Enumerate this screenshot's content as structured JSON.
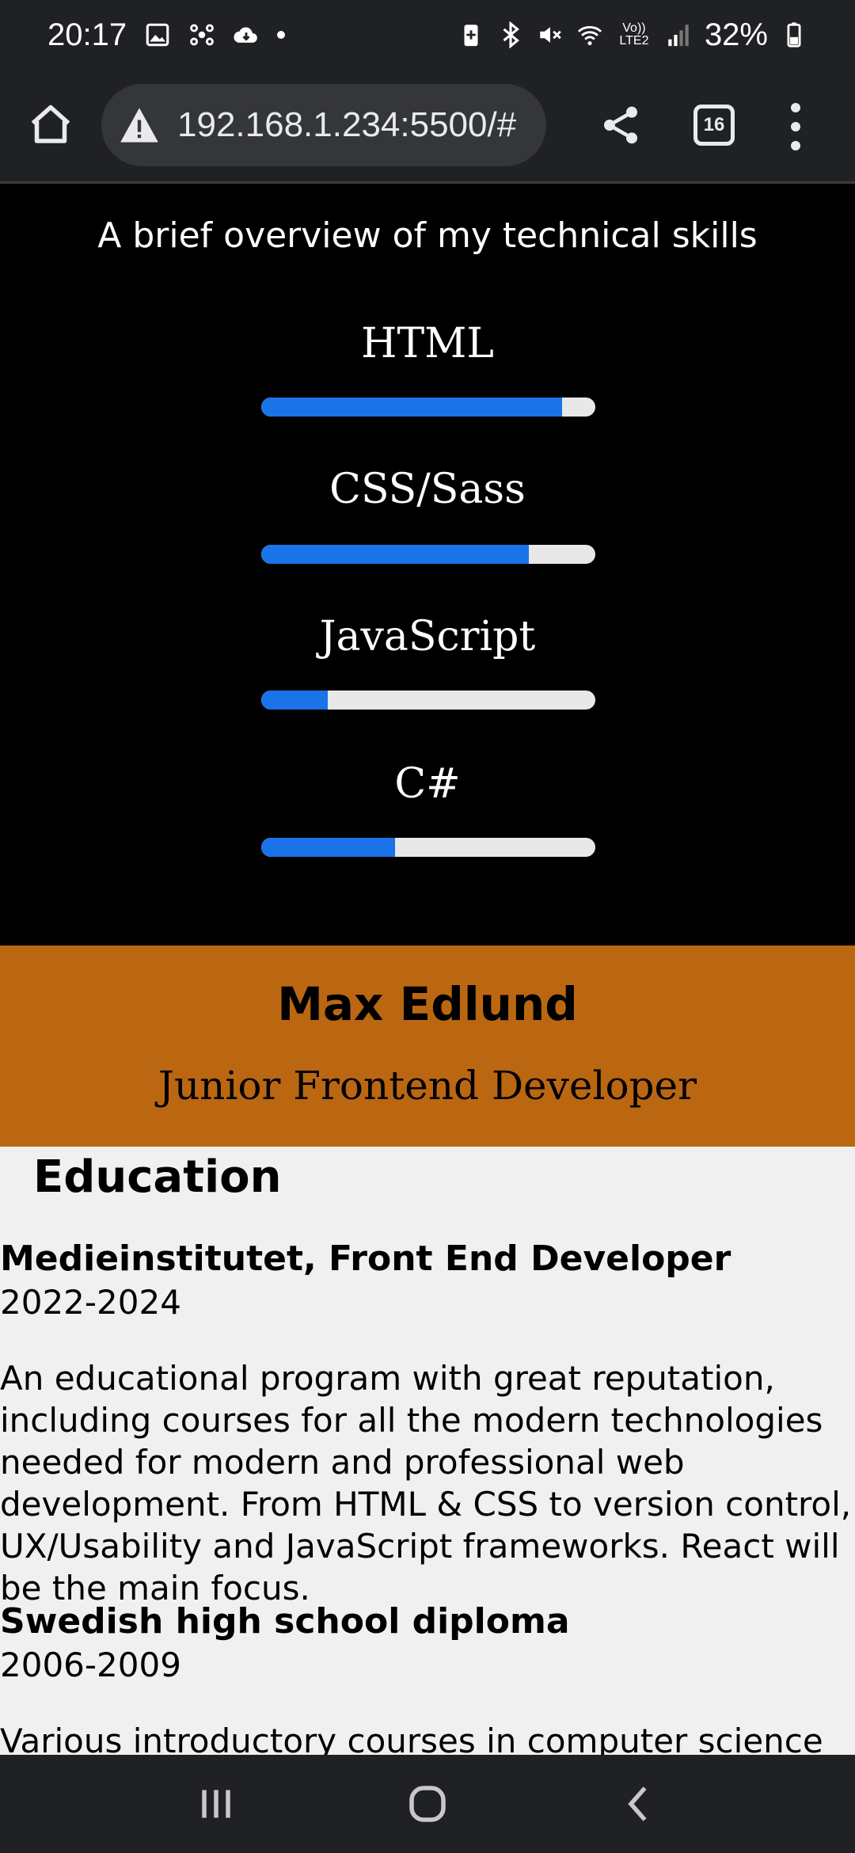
{
  "status_bar": {
    "time": "20:17",
    "battery": "32%",
    "network_label": "Vo)) LTE2"
  },
  "browser": {
    "url": "192.168.1.234:5500/#",
    "tab_count": "16"
  },
  "skills": {
    "intro": "A brief overview of my technical skills",
    "items": [
      {
        "label": "HTML",
        "level": 0.9
      },
      {
        "label": "CSS/Sass",
        "level": 0.8
      },
      {
        "label": "JavaScript",
        "level": 0.2
      },
      {
        "label": "C#",
        "level": 0.4
      }
    ]
  },
  "hero": {
    "name": "Max Edlund",
    "role": "Junior Frontend Developer"
  },
  "education": {
    "title": "Education",
    "items": [
      {
        "title": "Medieinstitutet, Front End Developer",
        "years": "2022-2024",
        "description": "An educational program with great reputation, including courses for all the modern technologies needed for modern and professional web development. From HTML & CSS to version control, UX/Usability and JavaScript frameworks. React will be the main focus."
      },
      {
        "title": "Swedish high school diploma",
        "years": "2006-2009",
        "description": "Various introductory courses in computer science and"
      }
    ]
  },
  "colors": {
    "accent": "#1a73e8",
    "hero_bg": "#bb6712",
    "education_bg": "#f0f0f0"
  },
  "icons": [
    "image-icon",
    "app-icon",
    "cloud-icon",
    "battery-saver-icon",
    "bluetooth-icon",
    "mute-icon",
    "wifi-icon",
    "signal-icon",
    "battery-icon",
    "home-icon",
    "warning-icon",
    "share-icon",
    "tabs-icon",
    "menu-icon",
    "recents-icon",
    "home-nav-icon",
    "back-icon"
  ]
}
